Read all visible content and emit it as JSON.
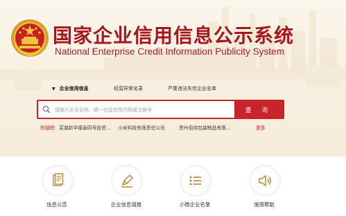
{
  "header": {
    "title_cn": "国家企业信用信息公示系统",
    "title_en": "National Enterprise Credit Information Publicity System"
  },
  "tabs": [
    {
      "label": "企业信用信息",
      "active": true
    },
    {
      "label": "经营异常名录",
      "active": false
    },
    {
      "label": "严重违法失信企业名单",
      "active": false
    }
  ],
  "search": {
    "placeholder": "请输入企业名称、统一社会信用代码或注册号",
    "button_label": "查 询"
  },
  "hot_search": {
    "label": "热搜榜:",
    "items": [
      "芜湖新华禧泰四号投资...",
      "小米科技有限责任公司",
      "贵州佰伟包装制品有限..."
    ],
    "more_label": "更多"
  },
  "features": [
    {
      "label": "信息公告",
      "icon": "document-icon"
    },
    {
      "label": "企业信息填报",
      "icon": "pen-icon"
    },
    {
      "label": "小微企业名录",
      "icon": "list-icon"
    },
    {
      "label": "使用帮助",
      "icon": "speaker-icon"
    }
  ],
  "colors": {
    "brand_red": "#c2262a",
    "title_red": "#a8171b",
    "banner_bg": "#f7efe0"
  }
}
